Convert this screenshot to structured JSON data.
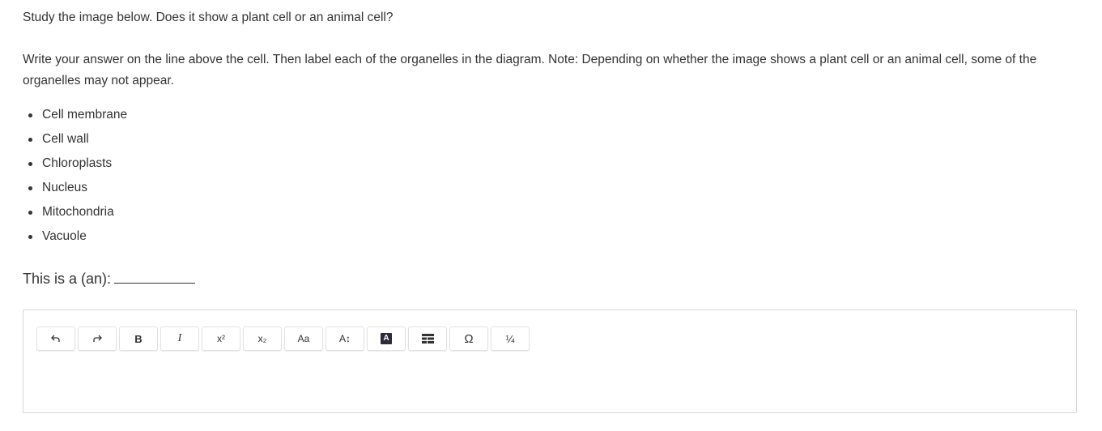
{
  "question": "Study the image below. Does it show a plant cell or an animal cell?",
  "instructions": "Write your answer on the line above the cell. Then label each of the organelles in the diagram. Note: Depending on whether the image shows a plant cell or an animal cell, some of the organelles may not appear.",
  "organelles": [
    "Cell membrane",
    "Cell wall",
    "Chloroplasts",
    "Nucleus",
    "Mitochondria",
    "Vacuole"
  ],
  "answer_prompt": "This is a (an):",
  "toolbar": {
    "buttons": [
      {
        "name": "undo",
        "icon": "undo-icon"
      },
      {
        "name": "redo",
        "icon": "redo-icon"
      },
      {
        "name": "bold",
        "label": "B"
      },
      {
        "name": "italic",
        "label": "I"
      },
      {
        "name": "superscript",
        "label": "x²"
      },
      {
        "name": "subscript",
        "label": "x₂"
      },
      {
        "name": "font-case",
        "label": "Aa"
      },
      {
        "name": "font-size",
        "label": "A↕"
      },
      {
        "name": "text-color",
        "label": "A"
      },
      {
        "name": "table",
        "icon": "table-icon"
      },
      {
        "name": "special-characters",
        "label": "Ω"
      },
      {
        "name": "fractions",
        "label": "¼"
      }
    ]
  }
}
